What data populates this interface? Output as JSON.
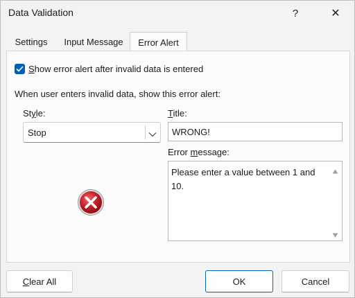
{
  "window": {
    "title": "Data Validation",
    "help_glyph": "?",
    "close_glyph": "✕"
  },
  "tabs": [
    {
      "label": "Settings",
      "active": false
    },
    {
      "label": "Input Message",
      "active": false
    },
    {
      "label": "Error Alert",
      "active": true
    }
  ],
  "error_alert": {
    "show_alert_checked": true,
    "show_alert_label": {
      "mnemonic": "S",
      "rest": "how error alert after invalid data is entered"
    },
    "section_label": "When user enters invalid data, show this error alert:",
    "style": {
      "label": {
        "pre": "St",
        "mnemonic": "y",
        "post": "le:"
      },
      "value": "Stop",
      "icon": "stop-error-icon"
    },
    "title": {
      "label": {
        "mnemonic": "T",
        "rest": "itle:"
      },
      "value": "WRONG!"
    },
    "error_message": {
      "label": {
        "pre": "Error ",
        "mnemonic": "m",
        "post": "essage:"
      },
      "value": "Please enter a value between 1 and 10."
    }
  },
  "footer": {
    "clear_all": {
      "mnemonic": "C",
      "rest": "lear All"
    },
    "ok": "OK",
    "cancel": "Cancel"
  },
  "colors": {
    "accent": "#005fb8",
    "stop_icon": "#c8212b"
  }
}
